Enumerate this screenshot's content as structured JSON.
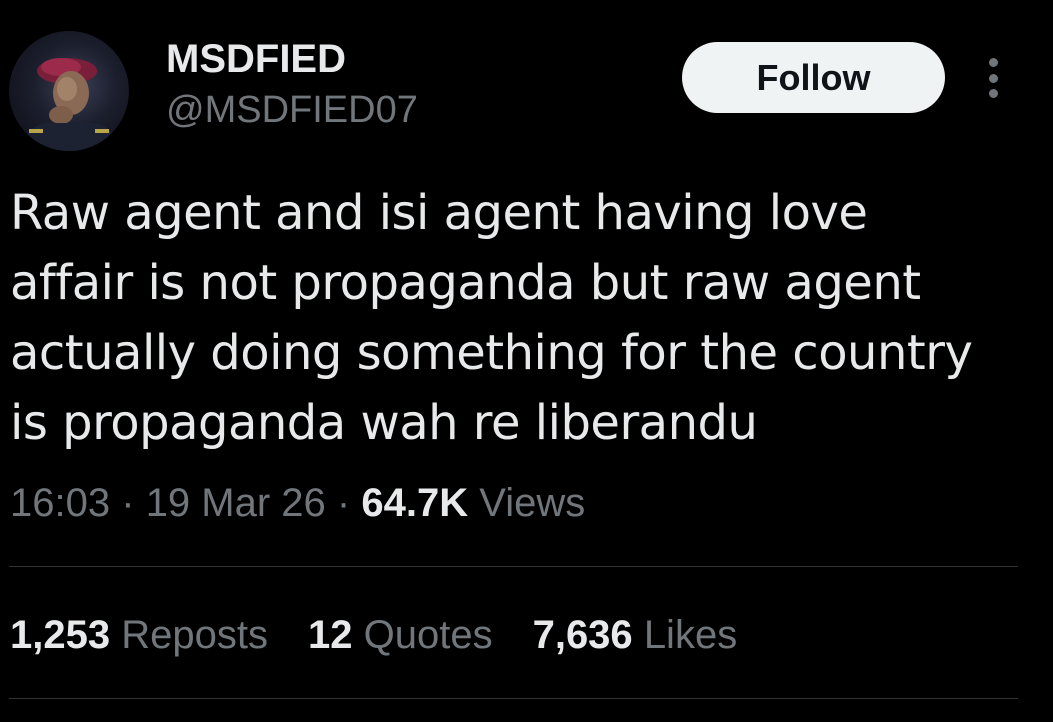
{
  "author": {
    "display_name": "MSDFIED",
    "handle": "@MSDFIED07",
    "avatar_icon": "profile-photo-avatar"
  },
  "actions": {
    "follow_label": "Follow",
    "more_icon": "more-vertical-icon"
  },
  "tweet": {
    "text_lines": [
      "Raw agent and isi agent having love",
      "affair is not propaganda but raw agent",
      "actually doing something for the country",
      "is propaganda wah re liberandu"
    ]
  },
  "meta": {
    "time": "16:03",
    "separator": "·",
    "date": "19 Mar 26",
    "views_count": "64.7K",
    "views_label": "Views"
  },
  "stats": [
    {
      "count": "1,253",
      "label": "Reposts"
    },
    {
      "count": "12",
      "label": "Quotes"
    },
    {
      "count": "7,636",
      "label": "Likes"
    }
  ],
  "colors": {
    "background": "#000000",
    "primary_text": "#e7e9ea",
    "secondary_text": "#71767b",
    "divider": "#2f3336",
    "follow_button_bg": "#eff3f4"
  }
}
